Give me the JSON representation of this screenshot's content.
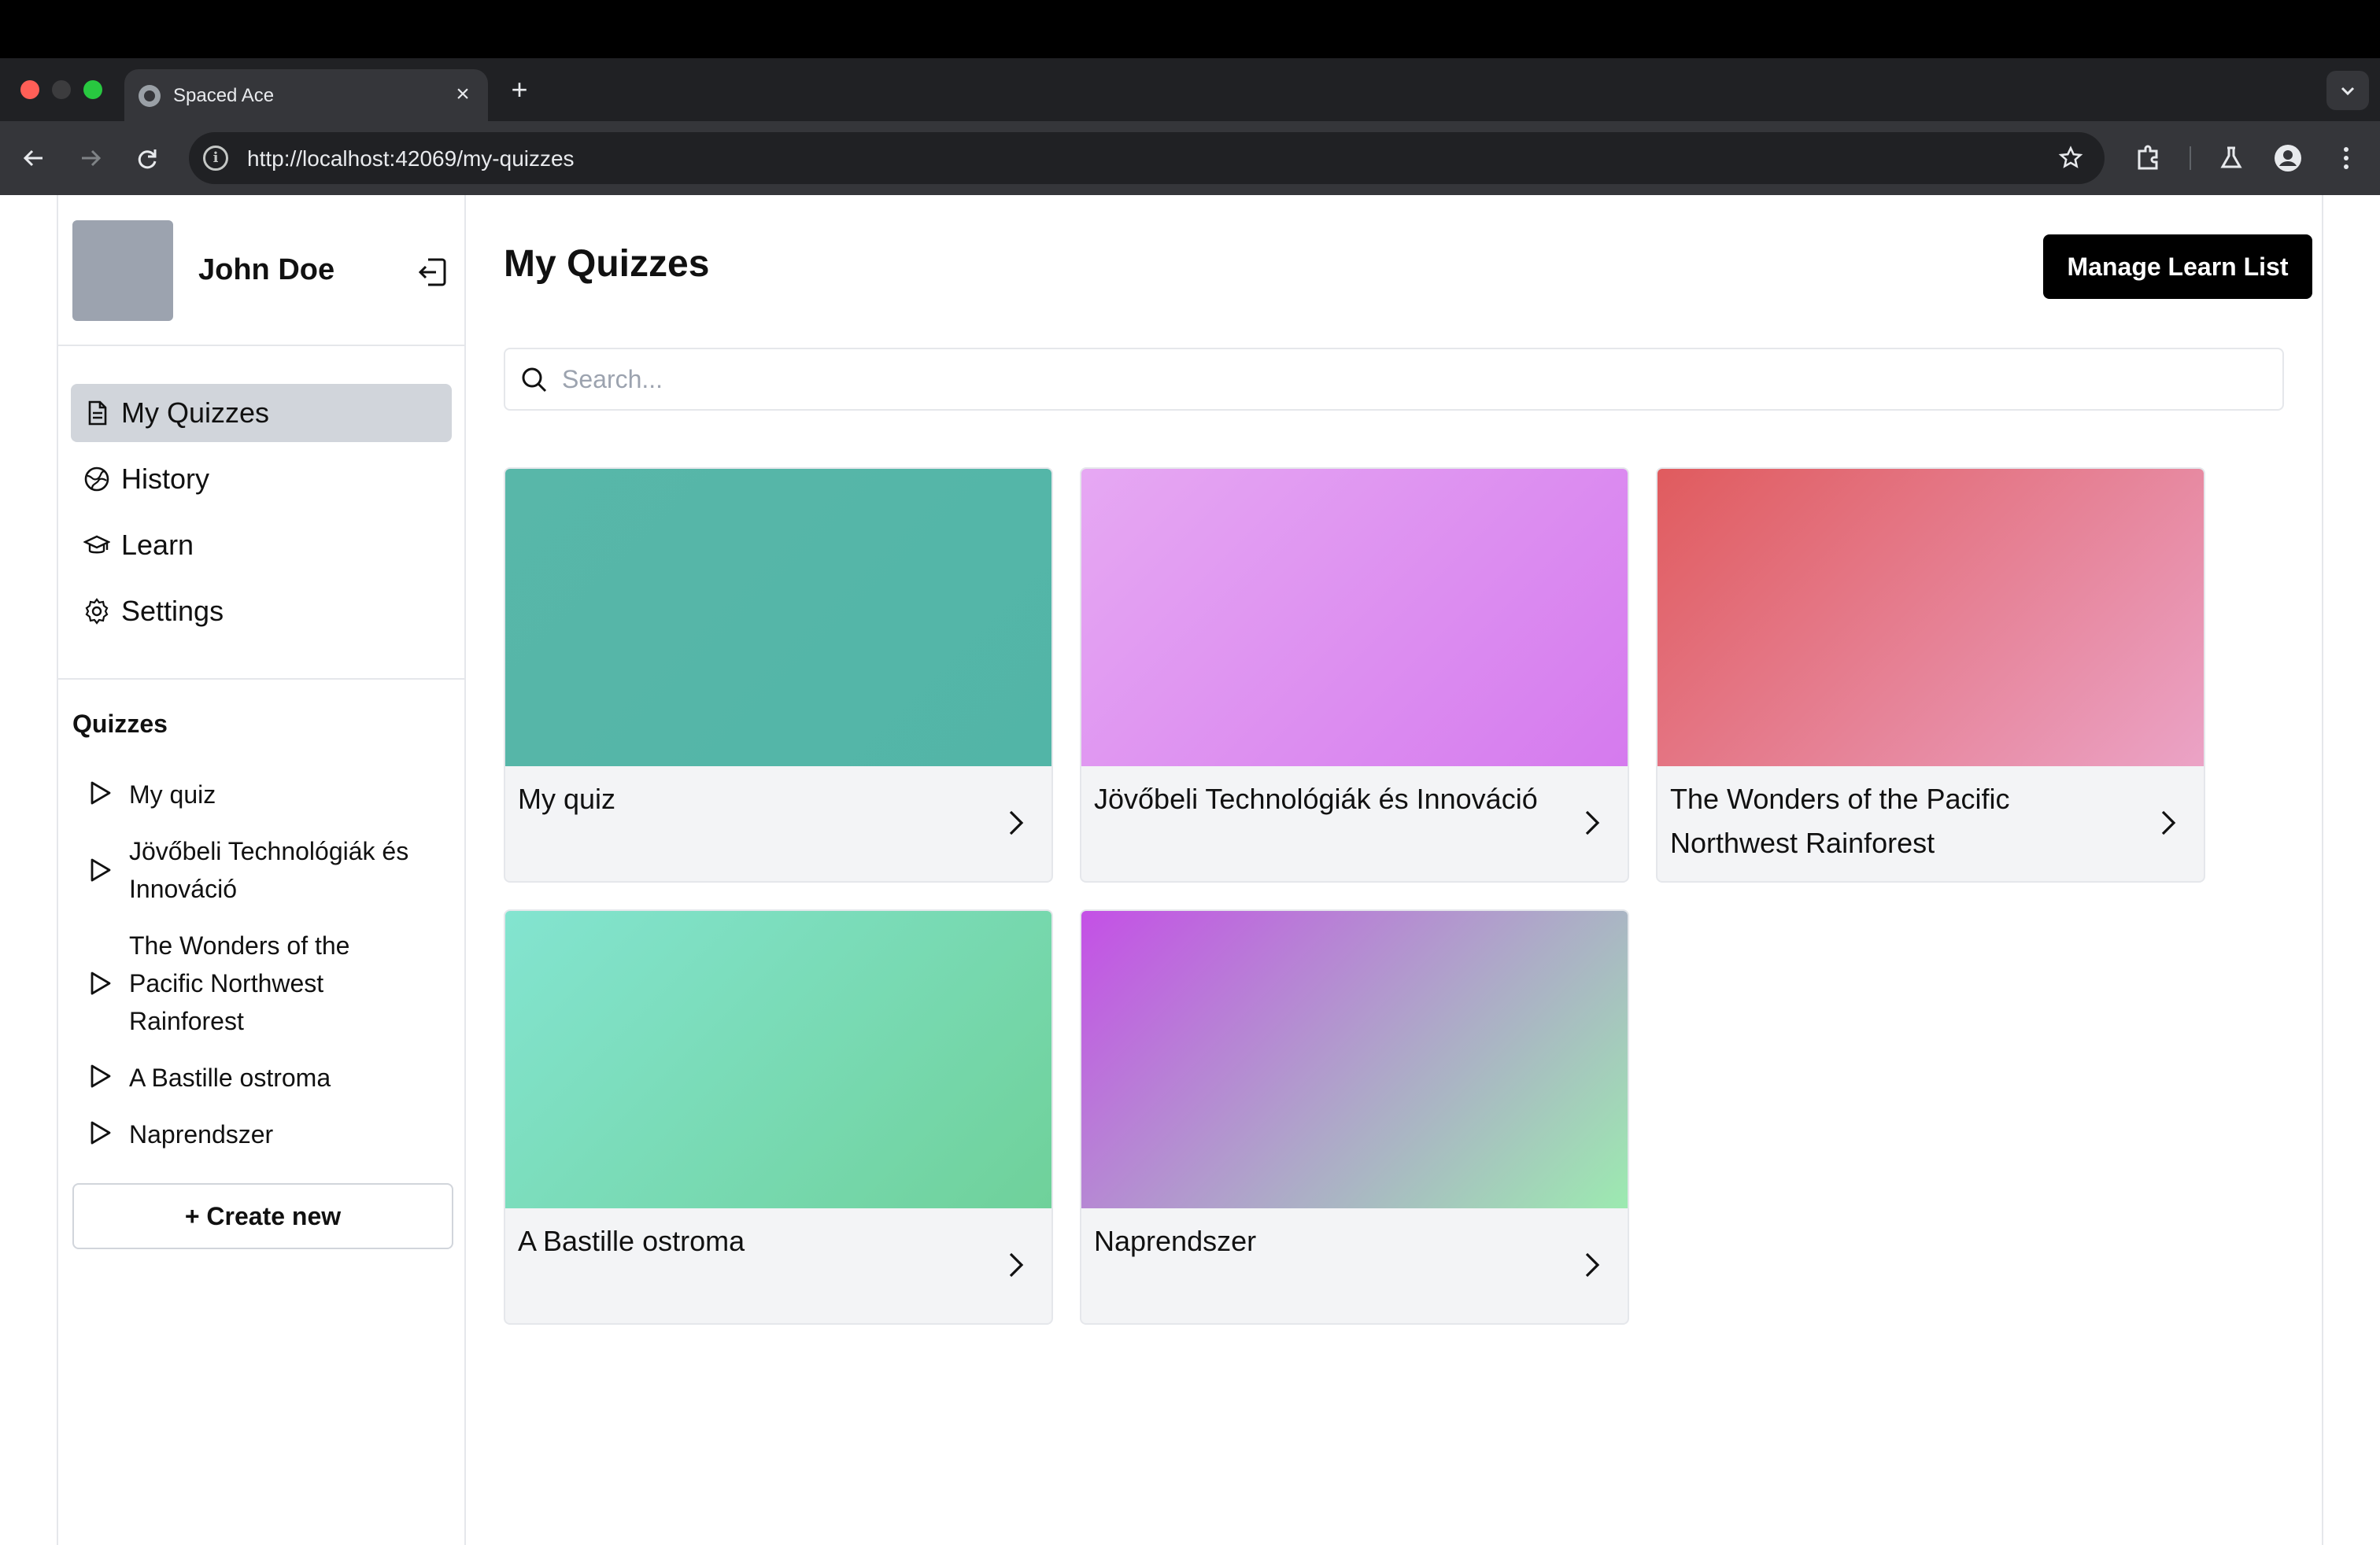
{
  "browser": {
    "tab_title": "Spaced Ace",
    "url": "http://localhost:42069/my-quizzes"
  },
  "sidebar": {
    "user_name": "John Doe",
    "nav": [
      {
        "label": "My Quizzes",
        "icon": "document-icon",
        "active": true
      },
      {
        "label": "History",
        "icon": "history-icon",
        "active": false
      },
      {
        "label": "Learn",
        "icon": "graduation-cap-icon",
        "active": false
      },
      {
        "label": "Settings",
        "icon": "gear-icon",
        "active": false
      }
    ],
    "quizzes_title": "Quizzes",
    "quizzes": [
      {
        "label": "My quiz"
      },
      {
        "label": "Jövőbeli Technológiák és Innováció"
      },
      {
        "label": "The Wonders of the Pacific Northwest Rainforest"
      },
      {
        "label": "A Bastille ostroma"
      },
      {
        "label": "Naprendszer"
      }
    ],
    "create_label": "+ Create new"
  },
  "main": {
    "title": "My Quizzes",
    "manage_label": "Manage Learn List",
    "search_placeholder": "Search...",
    "cards": [
      {
        "title": "My quiz",
        "cover": "linear-gradient(135deg,#58b7a9,#52b5a7)"
      },
      {
        "title": "Jövőbeli Technológiák és Innováció",
        "cover": "linear-gradient(135deg,#e6a8f3,#d57aee)"
      },
      {
        "title": "The Wonders of the Pacific Northwest Rainforest",
        "cover": "linear-gradient(135deg,#e05b5e,#eba3c6)"
      },
      {
        "title": "A Bastille ostroma",
        "cover": "linear-gradient(135deg,#83e4d0,#6fd19a)"
      },
      {
        "title": "Naprendszer",
        "cover": "linear-gradient(135deg,#c450e6,#aea7c9 55%,#9ceab0)"
      }
    ]
  }
}
